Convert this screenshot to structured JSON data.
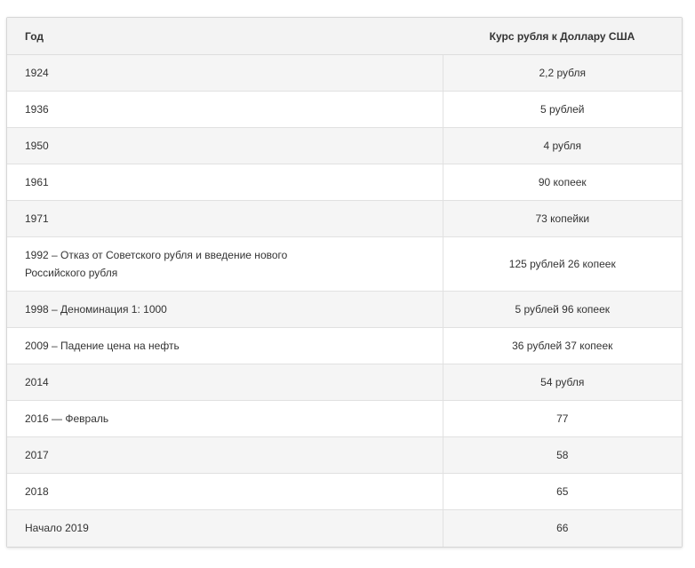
{
  "table": {
    "headers": {
      "year": "Год",
      "rate": "Курс рубля к Доллару США"
    },
    "rows": [
      {
        "year": "1924",
        "rate": "2,2 рубля"
      },
      {
        "year": "1936",
        "rate": "5 рублей"
      },
      {
        "year": "1950",
        "rate": "4 рубля"
      },
      {
        "year": "1961",
        "rate": "90 копеек"
      },
      {
        "year": "1971",
        "rate": "73 копейки"
      },
      {
        "year": "1992 – Отказ от Советского рубля и введение нового Российского рубля",
        "rate": "125 рублей 26 копеек"
      },
      {
        "year": "1998 – Деноминация 1: 1000",
        "rate": "5 рублей 96 копеек"
      },
      {
        "year": "2009 – Падение цена на нефть",
        "rate": "36 рублей 37 копеек"
      },
      {
        "year": "2014",
        "rate": "54 рубля"
      },
      {
        "year": "2016 — Февраль",
        "rate": "77"
      },
      {
        "year": "2017",
        "rate": "58"
      },
      {
        "year": "2018",
        "rate": "65"
      },
      {
        "year": "Начало 2019",
        "rate": "66"
      }
    ]
  },
  "colors": {
    "header_bg": "#f3f3f3",
    "row_odd_bg": "#f5f5f5",
    "row_even_bg": "#ffffff",
    "border": "#e1e1e1",
    "text": "#333333"
  }
}
